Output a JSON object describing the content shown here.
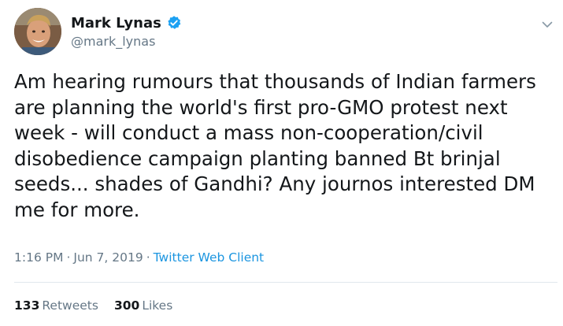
{
  "user": {
    "display_name": "Mark Lynas",
    "handle": "@mark_lynas",
    "verified": true,
    "verified_icon": "verified-badge-icon",
    "avatar_icon": "profile-photo"
  },
  "menu_icon": "chevron-down-icon",
  "tweet": {
    "lines": [
      "Am hearing rumours that thousands of Indian farmers",
      "are planning the world's first pro-GMO protest next",
      "week - will conduct a mass non-cooperation/civil",
      "disobedience campaign planting banned Bt brinjal",
      "seeds... shades of Gandhi? Any journos interested DM",
      "me for more."
    ],
    "time": "1:16 PM",
    "separator": "·",
    "date": "Jun 7, 2019",
    "client": "Twitter Web Client"
  },
  "stats": {
    "retweets_count": "133",
    "retweets_label": "Retweets",
    "likes_count": "300",
    "likes_label": "Likes"
  },
  "colors": {
    "text": "#14171a",
    "secondary": "#657786",
    "link": "#1b95e0",
    "verified": "#1da1f2",
    "divider": "#e1e8ed"
  }
}
